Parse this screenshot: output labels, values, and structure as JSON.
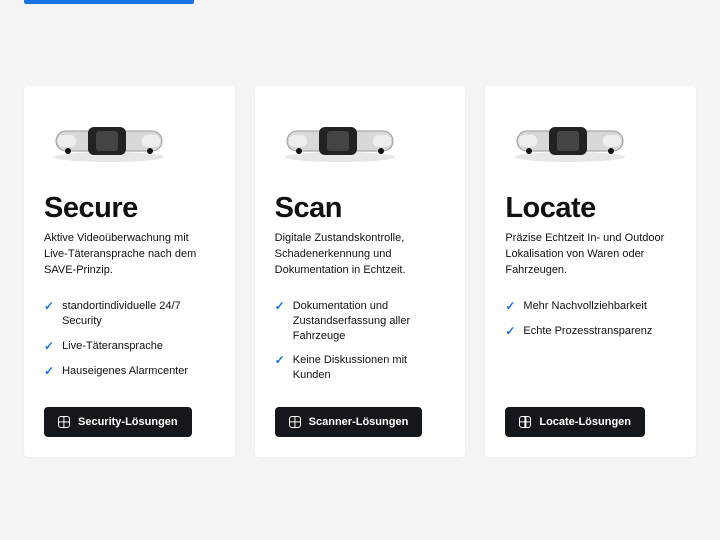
{
  "cards": [
    {
      "title": "Secure",
      "desc": "Aktive Videoüberwachung mit Live-Täteransprache nach dem SAVE-Prinzip.",
      "features": [
        "standortindividuelle 24/7 Security",
        "Live-Täteransprache",
        "Hauseigenes Alarmcenter"
      ],
      "button": "Security-Lösungen"
    },
    {
      "title": "Scan",
      "desc": "Digitale Zustandskontrolle, Schadenerkennung und Dokumentation in Echtzeit.",
      "features": [
        "Dokumentation und Zustandserfassung aller Fahrzeuge",
        "Keine Diskussionen mit Kunden"
      ],
      "button": "Scanner-Lösungen"
    },
    {
      "title": "Locate",
      "desc": "Präzise Echtzeit In- und Outdoor Lokalisation von Waren oder Fahrzeugen.",
      "features": [
        "Mehr Nachvollziehbarkeit",
        "Echte Prozesstransparenz"
      ],
      "button": "Locate-Lösungen"
    }
  ]
}
